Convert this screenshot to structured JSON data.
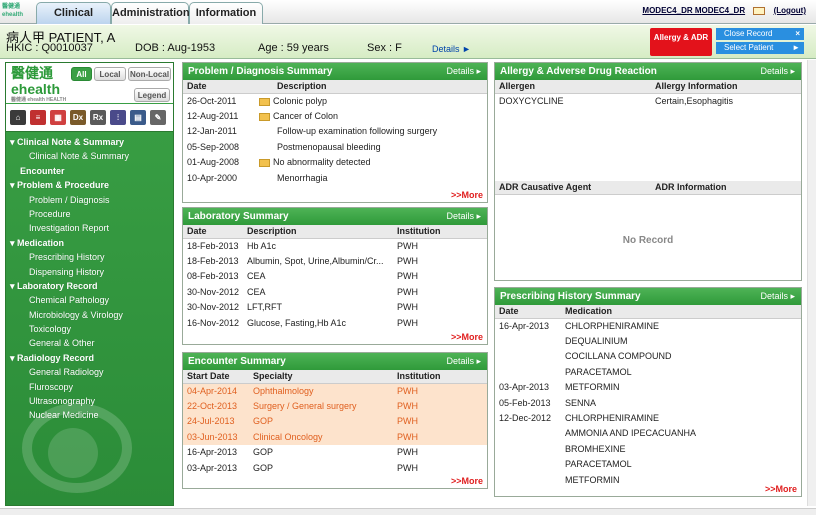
{
  "tabs": {
    "clinical": "Clinical",
    "administration": "Administration",
    "information": "Information"
  },
  "header": {
    "logo": "醫健通 ehealth",
    "user": "MODEC4_DR MODEC4_DR",
    "logout": "(Logout)"
  },
  "patient": {
    "name": "病人甲   PATIENT, A",
    "hkic": "HKIC : Q0010037",
    "dob": "DOB : Aug-1953",
    "age": "Age : 59 years",
    "sex": "Sex : F",
    "details": "Details ►"
  },
  "buttons": {
    "allergy": "Allergy & ADR",
    "close_record": "Close Record",
    "select_patient": "Select Patient"
  },
  "sidebar": {
    "brand": "醫健通",
    "brand2": "ehealth",
    "brand_sub": "醫健通 ehealth HEALTH",
    "filters": [
      "All",
      "Local",
      "Non-Local"
    ],
    "legend": "Legend",
    "icons": [
      "home-icon",
      "notes-icon",
      "calendar-icon",
      "dx-icon",
      "rx-icon",
      "lab-icon",
      "report-icon",
      "pen-icon"
    ],
    "menu": [
      {
        "t": "▾ Clinical Note & Summary",
        "c": "h"
      },
      {
        "t": "Clinical Note & Summary",
        "c": "s"
      },
      {
        "t": "Encounter",
        "c": "h2"
      },
      {
        "t": "▾ Problem & Procedure",
        "c": "h"
      },
      {
        "t": "Problem / Diagnosis",
        "c": "s"
      },
      {
        "t": "Procedure",
        "c": "s"
      },
      {
        "t": "Investigation Report",
        "c": "s"
      },
      {
        "t": "▾ Medication",
        "c": "h"
      },
      {
        "t": "Prescribing History",
        "c": "s"
      },
      {
        "t": "Dispensing History",
        "c": "s"
      },
      {
        "t": "▾ Laboratory Record",
        "c": "h"
      },
      {
        "t": "Chemical Pathology",
        "c": "s"
      },
      {
        "t": "Microbiology & Virology",
        "c": "s"
      },
      {
        "t": "Toxicology",
        "c": "s"
      },
      {
        "t": "General & Other",
        "c": "s"
      },
      {
        "t": "▾ Radiology Record",
        "c": "h"
      },
      {
        "t": "General Radiology",
        "c": "s"
      },
      {
        "t": "Fluroscopy",
        "c": "s"
      },
      {
        "t": "Ultrasonography",
        "c": "s"
      },
      {
        "t": "Nuclear Medicine",
        "c": "s"
      }
    ]
  },
  "problem": {
    "title": "Problem / Diagnosis Summary",
    "details": "Details ▸",
    "cols": [
      "Date",
      "",
      "Description"
    ],
    "more": ">>More",
    "rows": [
      [
        "26-Oct-2011",
        true,
        "Colonic polyp"
      ],
      [
        "12-Aug-2011",
        true,
        "Cancer of Colon"
      ],
      [
        "12-Jan-2011",
        false,
        "Follow-up examination following surgery"
      ],
      [
        "05-Sep-2008",
        false,
        "Postmenopausal bleeding"
      ],
      [
        "01-Aug-2008",
        true,
        "No abnormality detected"
      ],
      [
        "10-Apr-2000",
        false,
        "Menorrhagia"
      ]
    ]
  },
  "lab": {
    "title": "Laboratory Summary",
    "details": "Details ▸",
    "cols": [
      "Date",
      "Description",
      "Institution"
    ],
    "more": ">>More",
    "rows": [
      [
        "18-Feb-2013",
        "Hb A1c",
        "PWH"
      ],
      [
        "18-Feb-2013",
        "Albumin, Spot, Urine,Albumin/Cr...",
        "PWH"
      ],
      [
        "08-Feb-2013",
        "CEA",
        "PWH"
      ],
      [
        "30-Nov-2012",
        "CEA",
        "PWH"
      ],
      [
        "30-Nov-2012",
        "LFT,RFT",
        "PWH"
      ],
      [
        "16-Nov-2012",
        "Glucose, Fasting,Hb A1c",
        "PWH"
      ]
    ]
  },
  "encounter": {
    "title": "Encounter Summary",
    "details": "Details ▸",
    "cols": [
      "Start Date",
      "Specialty",
      "Institution"
    ],
    "more": ">>More",
    "rows": [
      [
        "04-Apr-2014",
        "Ophthalmology",
        "PWH",
        true
      ],
      [
        "22-Oct-2013",
        "Surgery / General surgery",
        "PWH",
        true
      ],
      [
        "24-Jul-2013",
        "GOP",
        "PWH",
        true
      ],
      [
        "03-Jun-2013",
        "Clinical Oncology",
        "PWH",
        true
      ],
      [
        "16-Apr-2013",
        "GOP",
        "PWH",
        false
      ],
      [
        "03-Apr-2013",
        "GOP",
        "PWH",
        false
      ]
    ]
  },
  "allergy": {
    "title": "Allergy & Adverse Drug Reaction",
    "details": "Details ▸",
    "cols": [
      "Allergen",
      "Allergy Information"
    ],
    "rows": [
      [
        "DOXYCYCLINE",
        "Certain,Esophagitis"
      ]
    ],
    "adr_cols": [
      "ADR Causative Agent",
      "ADR Information"
    ],
    "no_record": "No Record"
  },
  "prescribing": {
    "title": "Prescribing History Summary",
    "details": "Details ▸",
    "cols": [
      "Date",
      "Medication"
    ],
    "more": ">>More",
    "rows": [
      [
        "16-Apr-2013",
        "CHLORPHENIRAMINE"
      ],
      [
        "",
        "DEQUALINIUM"
      ],
      [
        "",
        "COCILLANA COMPOUND"
      ],
      [
        "",
        "PARACETAMOL"
      ],
      [
        "03-Apr-2013",
        "METFORMIN"
      ],
      [
        "05-Feb-2013",
        "SENNA"
      ],
      [
        "12-Dec-2012",
        "CHLORPHENIRAMINE"
      ],
      [
        "",
        "AMMONIA AND IPECACUANHA"
      ],
      [
        "",
        "BROMHEXINE"
      ],
      [
        "",
        "PARACETAMOL"
      ],
      [
        "",
        "METFORMIN"
      ]
    ]
  }
}
